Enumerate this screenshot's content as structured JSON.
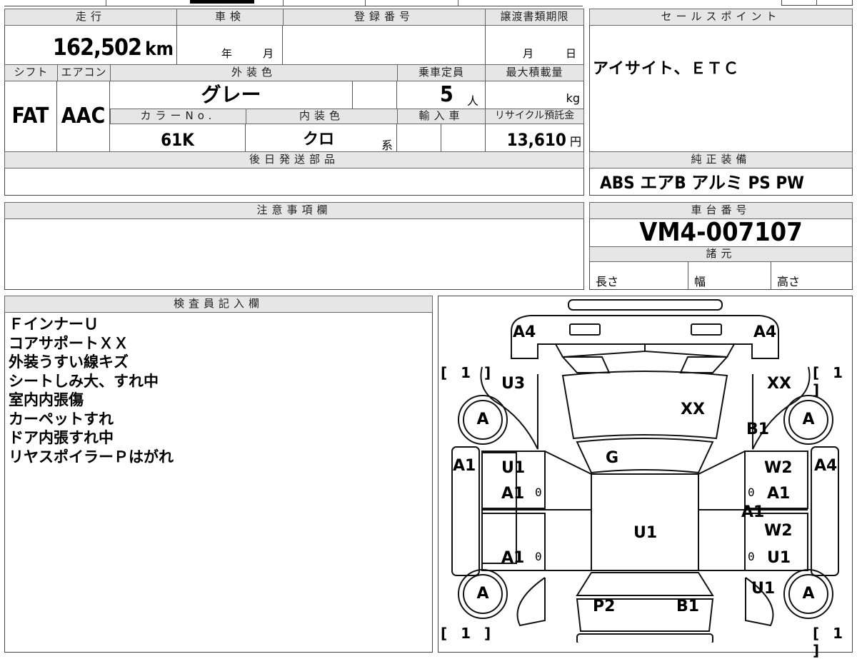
{
  "headers": {
    "mileage": "走行",
    "inspection": "車検",
    "registration": "登録番号",
    "transfer_deadline": "譲渡書類期限",
    "sales_point": "セールスポイント",
    "shift": "シフト",
    "aircon": "エアコン",
    "exterior_color": "外装色",
    "capacity": "乗車定員",
    "max_load": "最大積載量",
    "color_no": "カラーNo.",
    "interior_color": "内装色",
    "import": "輸入車",
    "recycle": "リサイクル預託金",
    "later_parts": "後日発送部品",
    "genuine_equipment": "純正装備",
    "caution": "注意事項欄",
    "chassis_no": "車台番号",
    "specs": "諸元",
    "inspector": "検査員記入欄"
  },
  "values": {
    "mileage": "162,502",
    "mileage_unit": "km",
    "year_label": "年",
    "month_label": "月",
    "transfer_month": "月",
    "transfer_day": "日",
    "sales_point": "アイサイト、ＥＴＣ",
    "shift": "FAT",
    "aircon": "AAC",
    "exterior_color": "グレー",
    "capacity": "5",
    "capacity_unit": "人",
    "max_load_unit": "kg",
    "color_no": "61K",
    "interior_color": "クロ",
    "interior_suffix": "系",
    "recycle": "13,610",
    "recycle_unit": "円",
    "genuine_equipment": "ABS エアB アルミ PS PW",
    "chassis_no": "VM4-007107",
    "length": "長さ",
    "width": "幅",
    "height": "高さ"
  },
  "inspector_notes": [
    "ＦインナーＵ",
    "コアサポートＸＸ",
    "外装うすい線キズ",
    "シートしみ大、すれ中",
    "室内内張傷",
    "カーペットすれ",
    "ドア内張すれ中",
    "リヤスポイラーＰはがれ"
  ],
  "diagram": {
    "labels": {
      "a4_left": "A4",
      "a4_right": "A4",
      "u3": "U3",
      "xx_right": "XX",
      "xx_hood": "XX",
      "b1_front": "B1",
      "g": "G",
      "a1_left": "A1",
      "u1_fl": "U1",
      "a1_fl": "A1",
      "w2_fr": "W2",
      "a1_fr": "A1",
      "a4_right_side": "A4",
      "a1_pillar": "A1",
      "w2_rr": "W2",
      "u1_roof": "U1",
      "a1_rl": "A1",
      "u1_rr": "U1",
      "u1_rear": "U1",
      "p2": "P2",
      "b1_rear": "B1"
    },
    "tire_label": "A",
    "bracket_text": "[ 1 ]",
    "depth_mark": "0"
  }
}
